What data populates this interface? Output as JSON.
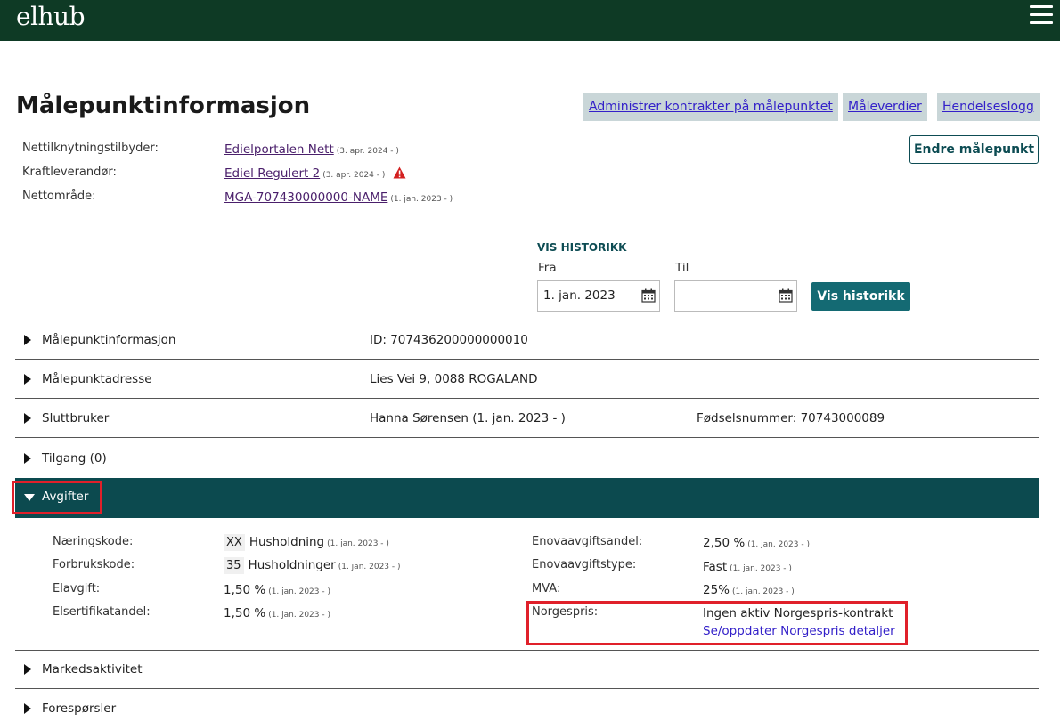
{
  "header": {
    "logo": "elhub",
    "menu_icon": "hamburger-menu-icon"
  },
  "page_title": "Målepunktinformasjon",
  "toplinks": [
    {
      "label": "Administrer kontrakter på målepunktet"
    },
    {
      "label": "Måleverdier"
    },
    {
      "label": "Hendelseslogg"
    }
  ],
  "endre_button": "Endre målepunkt",
  "info": [
    {
      "label": "Nettilknytningstilbyder:",
      "value": "Edielportalen Nett",
      "date": "(3. apr. 2024 - )",
      "warning": false
    },
    {
      "label": "Kraftleverandør:",
      "value": "Ediel Regulert 2",
      "date": "(3. apr. 2024 - )",
      "warning": true
    },
    {
      "label": "Nettområde:",
      "value": "MGA-707430000000-NAME",
      "date": "(1. jan. 2023 - )",
      "warning": false
    }
  ],
  "warning_color": "#d32020",
  "history": {
    "title": "VIS HISTORIKK",
    "from_label": "Fra",
    "from_value": "1. jan. 2023",
    "to_label": "Til",
    "to_value": "",
    "button": "Vis historikk"
  },
  "sections": [
    {
      "title": "Målepunktinformasjon",
      "col1": "ID: 707436200000000010",
      "col2": ""
    },
    {
      "title": "Målepunktadresse",
      "col1": "Lies Vei 9, 0088 ROGALAND",
      "col2": ""
    },
    {
      "title": "Sluttbruker",
      "col1": "Hanna Sørensen (1. jan. 2023 - )",
      "col2": "Fødselsnummer: 70743000089"
    },
    {
      "title": "Tilgang (0)",
      "col1": "",
      "col2": ""
    }
  ],
  "avgifter": {
    "title": "Avgifter",
    "left": [
      {
        "label": "Næringskode:",
        "code": "XX",
        "value": "Husholdning",
        "date": "(1. jan. 2023 - )"
      },
      {
        "label": "Forbrukskode:",
        "code": "35",
        "value": "Husholdninger",
        "date": "(1. jan. 2023 - )"
      },
      {
        "label": "Elavgift:",
        "code": "",
        "value": "1,50 %",
        "date": "(1. jan. 2023 - )"
      },
      {
        "label": "Elsertifikatandel:",
        "code": "",
        "value": "1,50 %",
        "date": "(1. jan. 2023 - )"
      }
    ],
    "right": [
      {
        "label": "Enovaavgiftsandel:",
        "value": "2,50 %",
        "date": "(1. jan. 2023 - )"
      },
      {
        "label": "Enovaavgiftstype:",
        "value": "Fast",
        "date": "(1. jan. 2023 - )"
      },
      {
        "label": "MVA:",
        "value": "25%",
        "date": "(1. jan. 2023 - )"
      }
    ],
    "norgespris": {
      "label": "Norgespris:",
      "value": "Ingen aktiv Norgespris-kontrakt",
      "link": "Se/oppdater Norgespris detaljer"
    }
  },
  "sections_after": [
    {
      "title": "Markedsaktivitet"
    },
    {
      "title": "Forespørsler"
    }
  ],
  "colors": {
    "header_bg": "#0e3a25",
    "accent": "#146a73",
    "section_open_bg": "#0c4a4f",
    "highlight": "#e0202a"
  }
}
